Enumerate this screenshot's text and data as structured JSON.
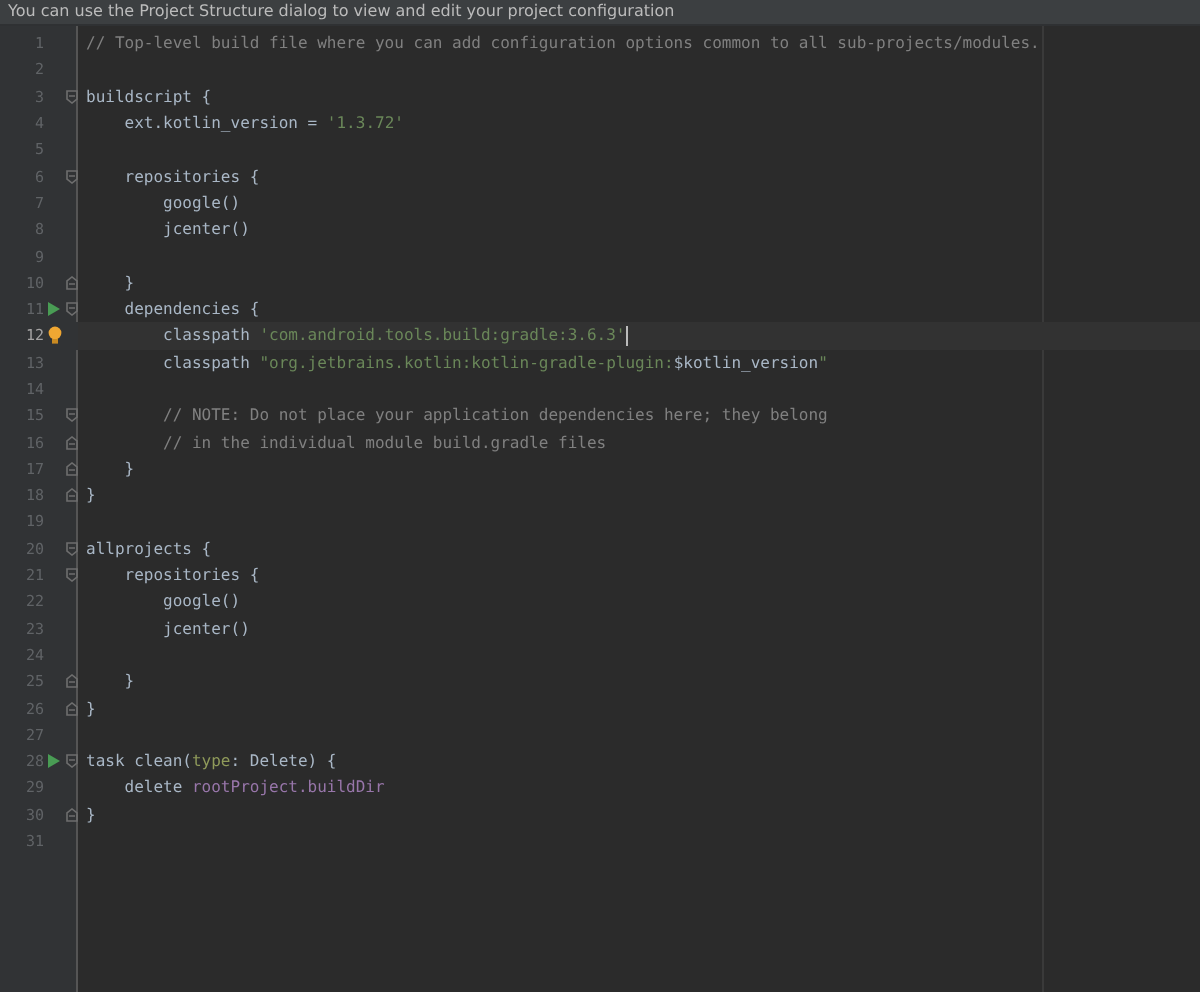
{
  "banner": {
    "text": "You can use the Project Structure dialog to view and edit your project configuration"
  },
  "editor": {
    "lines": [
      {
        "number": "1",
        "current": false,
        "segments": [
          {
            "kind": "comment",
            "text": "// Top-level build file where you can add configuration options common to all sub-projects/modules."
          }
        ]
      },
      {
        "number": "2",
        "current": false
      },
      {
        "number": "3",
        "current": false,
        "fold_start": true,
        "segments": [
          {
            "kind": "plain",
            "text": "buildscript {"
          }
        ]
      },
      {
        "number": "4",
        "current": false,
        "segments": [
          {
            "kind": "plain",
            "text": "    ext.kotlin_version = "
          },
          {
            "kind": "string",
            "text": "'1.3.72'"
          }
        ]
      },
      {
        "number": "5",
        "current": false
      },
      {
        "number": "6",
        "current": false,
        "fold_start": true,
        "segments": [
          {
            "kind": "plain",
            "text": "    repositories {"
          }
        ]
      },
      {
        "number": "7",
        "current": false,
        "segments": [
          {
            "kind": "plain",
            "text": "        google()"
          }
        ]
      },
      {
        "number": "8",
        "current": false,
        "segments": [
          {
            "kind": "plain",
            "text": "        jcenter()"
          }
        ]
      },
      {
        "number": "9",
        "current": false
      },
      {
        "number": "10",
        "current": false,
        "fold_end": true,
        "segments": [
          {
            "kind": "plain",
            "text": "    }"
          }
        ]
      },
      {
        "number": "11",
        "current": false,
        "runnable": true,
        "fold_start": true,
        "segments": [
          {
            "kind": "plain",
            "text": "    dependencies {"
          }
        ]
      },
      {
        "number": "12",
        "current": true,
        "intention": true,
        "segments": [
          {
            "kind": "plain",
            "text": "        classpath "
          },
          {
            "kind": "string",
            "text": "'com.android.tools.build:gradle:3.6.3'"
          }
        ]
      },
      {
        "number": "13",
        "current": false,
        "segments": [
          {
            "kind": "plain",
            "text": "        classpath "
          },
          {
            "kind": "string",
            "text": "\"org.jetbrains.kotlin:kotlin-gradle-plugin:"
          },
          {
            "kind": "plain",
            "text": "$kotlin_version"
          },
          {
            "kind": "string",
            "text": "\""
          }
        ]
      },
      {
        "number": "14",
        "current": false
      },
      {
        "number": "15",
        "current": false,
        "fold_start": true,
        "segments": [
          {
            "kind": "comment",
            "text": "        // NOTE: Do not place your application dependencies here; they belong"
          }
        ]
      },
      {
        "number": "16",
        "current": false,
        "fold_end": true,
        "segments": [
          {
            "kind": "comment",
            "text": "        // in the individual module build.gradle files"
          }
        ]
      },
      {
        "number": "17",
        "current": false,
        "fold_end": true,
        "segments": [
          {
            "kind": "plain",
            "text": "    }"
          }
        ]
      },
      {
        "number": "18",
        "current": false,
        "fold_end": true,
        "segments": [
          {
            "kind": "plain",
            "text": "}"
          }
        ]
      },
      {
        "number": "19",
        "current": false
      },
      {
        "number": "20",
        "current": false,
        "fold_start": true,
        "segments": [
          {
            "kind": "plain",
            "text": "allprojects {"
          }
        ]
      },
      {
        "number": "21",
        "current": false,
        "fold_start": true,
        "segments": [
          {
            "kind": "plain",
            "text": "    repositories {"
          }
        ]
      },
      {
        "number": "22",
        "current": false,
        "segments": [
          {
            "kind": "plain",
            "text": "        google()"
          }
        ]
      },
      {
        "number": "23",
        "current": false,
        "segments": [
          {
            "kind": "plain",
            "text": "        jcenter()"
          }
        ]
      },
      {
        "number": "24",
        "current": false
      },
      {
        "number": "25",
        "current": false,
        "fold_end": true,
        "segments": [
          {
            "kind": "plain",
            "text": "    }"
          }
        ]
      },
      {
        "number": "26",
        "current": false,
        "fold_end": true,
        "segments": [
          {
            "kind": "plain",
            "text": "}"
          }
        ]
      },
      {
        "number": "27",
        "current": false
      },
      {
        "number": "28",
        "current": false,
        "runnable": true,
        "fold_start": true,
        "segments": [
          {
            "kind": "plain",
            "text": "task clean("
          },
          {
            "kind": "param",
            "text": "type"
          },
          {
            "kind": "plain",
            "text": ": Delete) {"
          }
        ]
      },
      {
        "number": "29",
        "current": false,
        "segments": [
          {
            "kind": "plain",
            "text": "    delete "
          },
          {
            "kind": "field",
            "text": "rootProject.buildDir"
          }
        ]
      },
      {
        "number": "30",
        "current": false,
        "fold_end": true,
        "segments": [
          {
            "kind": "plain",
            "text": "}"
          }
        ]
      },
      {
        "number": "31",
        "current": false
      }
    ]
  }
}
